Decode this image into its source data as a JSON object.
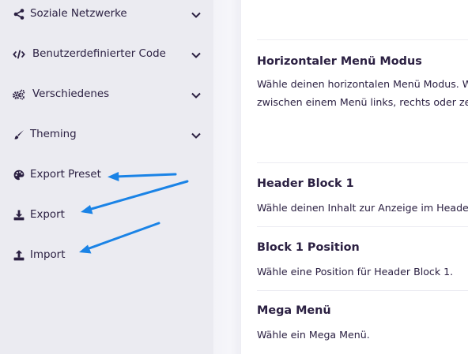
{
  "sidebar": {
    "items": [
      {
        "label": "Soziale Netzwerke",
        "icon": "share-icon",
        "expandable": true
      },
      {
        "label": "Benutzerdefinierter Code",
        "icon": "code-icon",
        "expandable": true
      },
      {
        "label": "Verschiedenes",
        "icon": "cogs-icon",
        "expandable": true
      },
      {
        "label": "Theming",
        "icon": "brush-icon",
        "expandable": true
      },
      {
        "label": "Export Preset",
        "icon": "palette-icon",
        "expandable": false
      },
      {
        "label": "Export",
        "icon": "download-icon",
        "expandable": false
      },
      {
        "label": "Import",
        "icon": "upload-icon",
        "expandable": false
      }
    ]
  },
  "main": {
    "sections": [
      {
        "title": "Horizontaler Menü Modus",
        "desc_line1": "Wähle deinen horizontalen Menü Modus. W",
        "desc_line2": "zwischen einem Menü links, rechts oder zen"
      },
      {
        "title": "Header Block 1",
        "desc_line1": "Wähle deinen Inhalt zur Anzeige im Heade"
      },
      {
        "title": "Block 1 Position",
        "desc_line1": "Wähle eine Position für Header Block 1."
      },
      {
        "title": "Mega Menü",
        "desc_line1": "Wähle ein Mega Menü."
      }
    ]
  },
  "colors": {
    "sidebar_bg": "#ebebf1",
    "text": "#2b2042",
    "annotation_arrow": "#1a83e6"
  }
}
